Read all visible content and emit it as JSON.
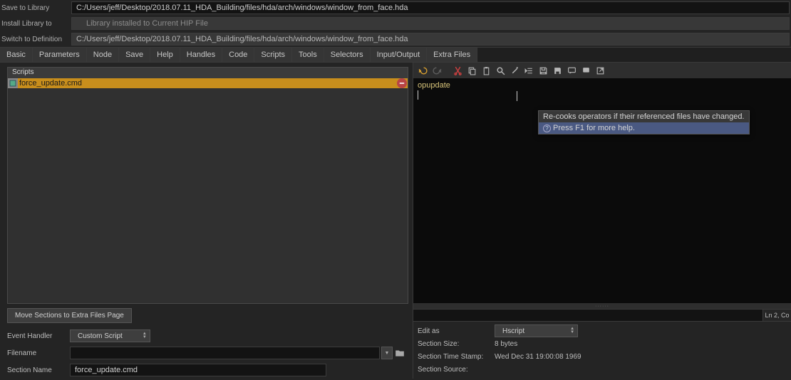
{
  "paths": {
    "save_label": "Save to Library",
    "save_path": "C:/Users/jeff/Desktop/2018.07.11_HDA_Building/files/hda/arch/windows/window_from_face.hda",
    "install_label": "Install Library to",
    "install_value": "Library installed to Current HIP File",
    "switch_label": "Switch to Definition",
    "switch_path": "C:/Users/jeff/Desktop/2018.07.11_HDA_Building/files/hda/arch/windows/window_from_face.hda"
  },
  "tabs": [
    "Basic",
    "Parameters",
    "Node",
    "Save",
    "Help",
    "Handles",
    "Code",
    "Scripts",
    "Tools",
    "Selectors",
    "Input/Output",
    "Extra Files"
  ],
  "scripts": {
    "title": "Scripts",
    "item": "force_update.cmd",
    "move_button": "Move Sections to Extra Files Page"
  },
  "left_form": {
    "event_handler_label": "Event Handler",
    "event_handler_value": "Custom Script",
    "filename_label": "Filename",
    "filename_value": "",
    "section_name_label": "Section Name",
    "section_name_value": "force_update.cmd"
  },
  "editor": {
    "code": "opupdate",
    "status": "Ln 2, Co"
  },
  "right_form": {
    "editas_label": "Edit as",
    "editas_value": "Hscript",
    "section_size_label": "Section Size:",
    "section_size_value": "8 bytes",
    "time_stamp_label": "Section Time Stamp:",
    "time_stamp_value": "Wed Dec 31 19:00:08 1969",
    "source_label": "Section Source:"
  },
  "tooltip": {
    "line1": "Re-cooks operators if their referenced files have changed.",
    "line2": "Press F1 for more help."
  },
  "icons": {
    "undo": "undo",
    "redo": "redo",
    "cut": "cut",
    "copy": "copy",
    "paste": "paste",
    "find": "search",
    "wand": "magic",
    "indent": "indent",
    "save1": "disk",
    "save2": "disk-b",
    "comment": "comment",
    "bubble": "bubble",
    "ext": "external"
  }
}
